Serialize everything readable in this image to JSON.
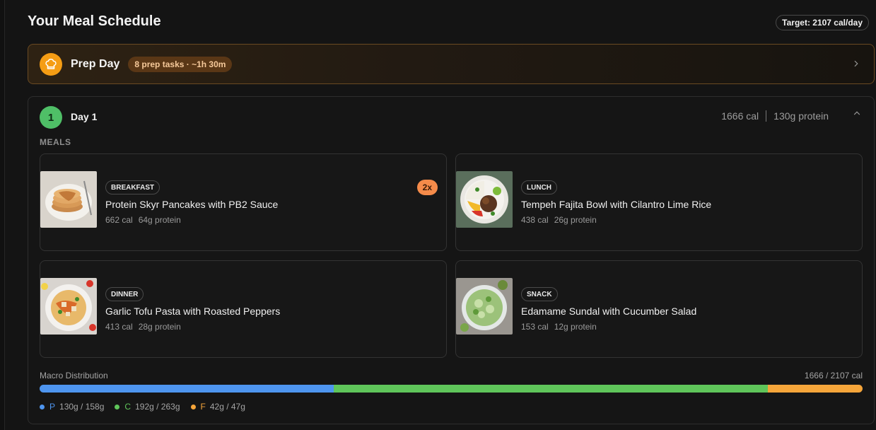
{
  "header": {
    "title": "Your Meal Schedule",
    "target": "Target: 2107 cal/day"
  },
  "prep": {
    "title": "Prep Day",
    "badge": "8 prep tasks · ~1h 30m",
    "icon": "chef-hat-icon"
  },
  "day": {
    "number": "1",
    "title": "Day 1",
    "calories": "1666 cal",
    "protein": "130g protein",
    "meals_label": "MEALS",
    "meals": [
      {
        "type": "BREAKFAST",
        "name": "Protein Skyr Pancakes with PB2 Sauce",
        "cal": "662 cal",
        "protein": "64g protein",
        "multiplier": "2x"
      },
      {
        "type": "LUNCH",
        "name": "Tempeh Fajita Bowl with Cilantro Lime Rice",
        "cal": "438 cal",
        "protein": "26g protein"
      },
      {
        "type": "DINNER",
        "name": "Garlic Tofu Pasta with Roasted Peppers",
        "cal": "413 cal",
        "protein": "28g protein"
      },
      {
        "type": "SNACK",
        "name": "Edamame Sundal with Cucumber Salad",
        "cal": "153 cal",
        "protein": "12g protein"
      }
    ],
    "macro": {
      "label": "Macro Distribution",
      "total": "1666 / 2107 cal",
      "protein": {
        "key": "P",
        "text": "130g / 158g",
        "color": "#4e95ef",
        "share": 0.357
      },
      "carbs": {
        "key": "C",
        "text": "192g / 263g",
        "color": "#5fc55a",
        "share": 0.528
      },
      "fat": {
        "key": "F",
        "text": "42g / 47g",
        "color": "#f5a53a",
        "share": 0.115
      }
    }
  }
}
